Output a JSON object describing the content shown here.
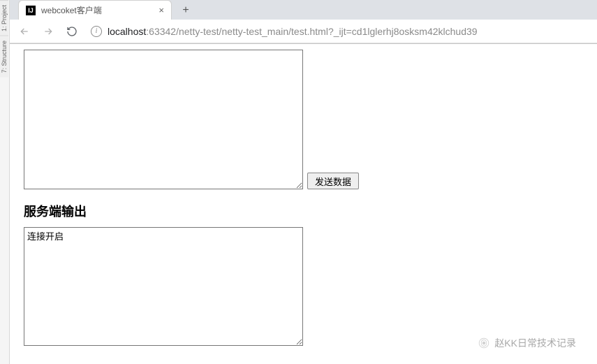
{
  "browser": {
    "tab": {
      "favicon_letter": "IJ",
      "title": "webcoket客户端",
      "close_glyph": "×"
    },
    "new_tab_glyph": "+",
    "nav": {
      "back_glyph": "←",
      "forward_glyph": "→",
      "reload_glyph": "⟳"
    },
    "site_info_glyph": "i",
    "url_host": "localhost",
    "url_port_path": ":63342/netty-test/netty-test_main/test.html?_ijt=cd1lglerhj8osksm42klchud39"
  },
  "ide_side": {
    "tab1": "1: Project",
    "tab2": "7: Structure"
  },
  "page": {
    "input_value": "",
    "send_button_label": "发送数据",
    "output_heading": "服务端输出",
    "output_value": "连接开启"
  },
  "watermark": {
    "icon_glyph": "✦",
    "text": "赵KK日常技术记录"
  }
}
